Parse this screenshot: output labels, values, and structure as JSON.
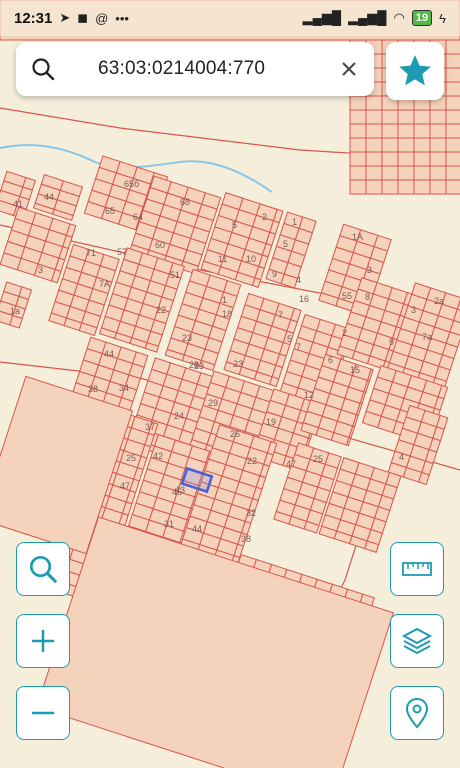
{
  "status_bar": {
    "time": "12:31",
    "left_icons": [
      "telegram-icon",
      "vk-icon",
      "at-icon",
      "more-dots-icon"
    ],
    "right_icons": [
      "signal-icon",
      "signal-icon",
      "wifi-icon",
      "battery-icon",
      "charging-icon"
    ],
    "battery_level": "19"
  },
  "search": {
    "icon": "search-icon",
    "value": "63:03:0214004:770",
    "clear_icon": "close-icon"
  },
  "favorite": {
    "icon": "star-icon",
    "color": "#1e9bb2"
  },
  "map": {
    "background_color": "#f4eedb",
    "parcel_fill": "#f5d2bb",
    "parcel_stroke": "#d8564b",
    "water_color": "#8ac6e6",
    "selected_stroke": "#4a5fd6",
    "block_labels": [
      "44",
      "41",
      "65б",
      "65",
      "64",
      "68",
      "5",
      "2",
      "1",
      "1А",
      "71",
      "57",
      "60",
      "11",
      "10",
      "9",
      "5",
      "3",
      "4",
      "3",
      "7А",
      "51",
      "16",
      "7",
      "8",
      "2а",
      "1а",
      "55",
      "3",
      "22",
      "23",
      "18",
      "1",
      "2",
      "7а",
      "44",
      "23",
      "7",
      "6",
      "9",
      "38",
      "34",
      "28",
      "23",
      "15",
      "5",
      "12",
      "29",
      "19",
      "37",
      "24",
      "26",
      "25",
      "42",
      "47",
      "22",
      "25",
      "4",
      "45",
      "47",
      "43",
      "32",
      "31",
      "38",
      "44"
    ]
  },
  "controls": {
    "zoom_search": "search-icon",
    "zoom_in": "plus-icon",
    "zoom_out": "minus-icon",
    "ruler": "ruler-icon",
    "layers": "layers-icon",
    "location": "location-pin-icon"
  }
}
